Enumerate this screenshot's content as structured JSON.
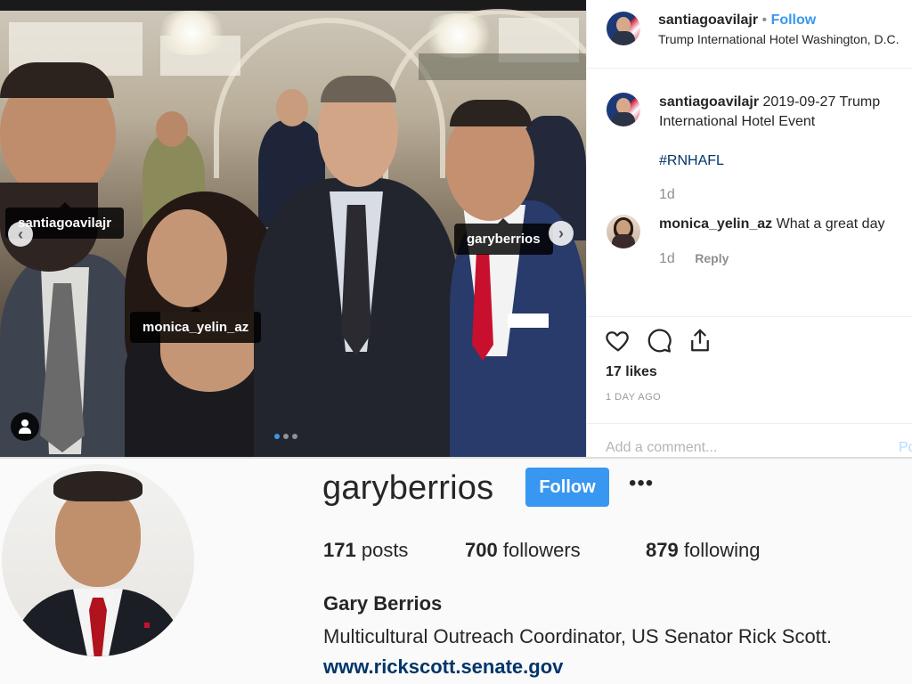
{
  "post": {
    "header": {
      "username": "santiagoavilajr",
      "separator": "•",
      "follow_label": "Follow",
      "location": "Trump International Hotel Washington, D.C."
    },
    "photo_tags": [
      "santiagoavilajr",
      "monica_yelin_az",
      "garyberrios"
    ],
    "caption": {
      "username": "santiagoavilajr",
      "text": "2019-09-27 Trump International Hotel Event",
      "hashtag": "#RNHAFL",
      "age": "1d"
    },
    "comments": [
      {
        "username": "monica_yelin_az",
        "text": "What a great day",
        "age": "1d",
        "reply_label": "Reply"
      }
    ],
    "likes": "17 likes",
    "posted_ago": "1 DAY AGO",
    "comment_placeholder": "Add a comment...",
    "post_label": "Po",
    "icons": [
      "heart-icon",
      "comment-icon",
      "share-icon",
      "tagged-user-icon",
      "arrow-left-icon",
      "arrow-right-icon"
    ]
  },
  "profile": {
    "username": "garyberrios",
    "follow_label": "Follow",
    "more_label": "•••",
    "stats": [
      {
        "count": "171",
        "label": "posts"
      },
      {
        "count": "700",
        "label": "followers"
      },
      {
        "count": "879",
        "label": "following"
      }
    ],
    "full_name": "Gary Berrios",
    "bio": "Multicultural Outreach Coordinator, US Senator Rick Scott.",
    "website": "www.rickscott.senate.gov"
  },
  "colors": {
    "accent": "#3897f0",
    "link": "#003569",
    "muted": "#8e8e8e"
  }
}
